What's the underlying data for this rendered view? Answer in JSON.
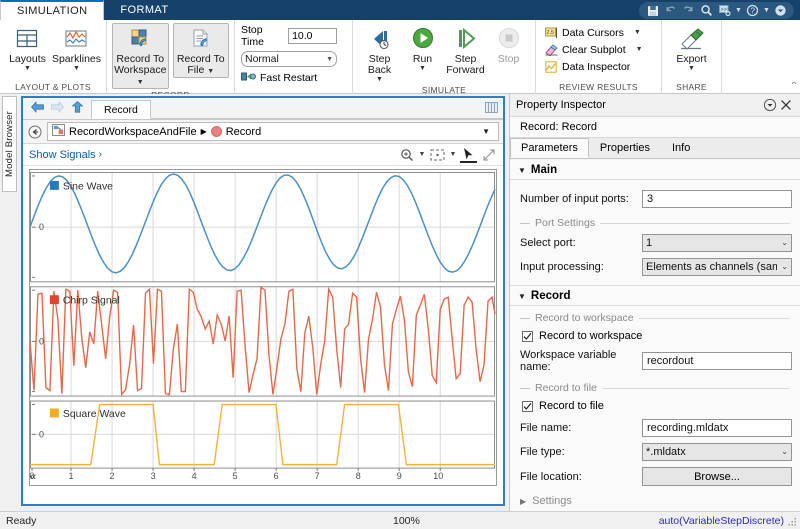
{
  "window": {
    "tabs": [
      {
        "label": "SIMULATION",
        "active": true
      },
      {
        "label": "FORMAT",
        "active": false
      }
    ],
    "quick_access": [
      "save-icon",
      "undo-icon",
      "redo-icon",
      "search-icon",
      "shortcuts-icon",
      "chevron-down-icon",
      "help-icon",
      "chevron-down-icon-2",
      "expand-icon"
    ]
  },
  "ribbon": {
    "groups": [
      {
        "title": "LAYOUT & PLOTS",
        "buttons": [
          {
            "label": "Layouts",
            "icon": "layouts-icon",
            "caret": true
          },
          {
            "label": "Sparklines",
            "icon": "sparklines-icon",
            "caret": true
          }
        ]
      },
      {
        "title": "RECORD",
        "buttons": [
          {
            "label": "Record To Workspace",
            "icon": "record-to-workspace-icon",
            "caret": true
          },
          {
            "label": "Record To File",
            "icon": "record-to-file-icon",
            "caret": true
          }
        ]
      },
      {
        "title": "",
        "stop_time_label": "Stop Time",
        "stop_time_value": "10.0",
        "sim_mode": "Normal",
        "fast_restart": "Fast Restart"
      },
      {
        "title": "SIMULATE",
        "buttons": [
          {
            "label": "Step Back",
            "icon": "step-back-icon",
            "caret": true
          },
          {
            "label": "Run",
            "icon": "run-icon",
            "caret": true
          },
          {
            "label": "Step Forward",
            "icon": "step-forward-icon",
            "caret": false
          },
          {
            "label": "Stop",
            "icon": "stop-icon",
            "caret": false,
            "disabled": true
          }
        ]
      },
      {
        "title": "REVIEW RESULTS",
        "items": [
          {
            "label": "Data Cursors",
            "icon": "data-cursors-icon",
            "caret": true
          },
          {
            "label": "Clear Subplot",
            "icon": "clear-subplot-icon",
            "caret": true
          },
          {
            "label": "Data Inspector",
            "icon": "data-inspector-icon",
            "caret": false
          }
        ]
      },
      {
        "title": "SHARE",
        "buttons": [
          {
            "label": "Export",
            "icon": "export-icon",
            "caret": true
          }
        ]
      }
    ]
  },
  "model_browser": {
    "label": "Model Browser"
  },
  "scope": {
    "tab_label": "Record",
    "breadcrumb": {
      "model": "RecordWorkspaceAndFile",
      "separator": "▶",
      "block": "Record"
    },
    "show_signals": "Show Signals",
    "show_signals_caret": "›",
    "tools": [
      "zoom-in-icon",
      "pan-fit-icon",
      "cursor-icon",
      "maximize-icon"
    ]
  },
  "chart_data": {
    "type": "line",
    "title": "",
    "xlabel": "",
    "ylabel": "",
    "xlim": [
      0,
      10
    ],
    "xticks": [
      0,
      1,
      2,
      3,
      4,
      5,
      6,
      7,
      8,
      9,
      10
    ],
    "grid": true,
    "subplots": [
      {
        "name": "Sine Wave",
        "color": "#4a90c4",
        "ylim": [
          -1.25,
          1.25
        ],
        "yticks": [
          0
        ],
        "ytick_labels": [
          "0"
        ],
        "description": "Sine wave, amplitude 1, about 3.5 cycles over 0 to 10 seconds"
      },
      {
        "name": "Chirp Signal",
        "color": "#e2694a",
        "ylim": [
          -1.25,
          1.25
        ],
        "yticks": [
          0
        ],
        "ytick_labels": [
          "0"
        ],
        "description": "Chirp signal sampled coarsely, increasing frequency, amplitude 1 over 0 to 10 seconds"
      },
      {
        "name": "Square Wave",
        "color": "#f2b33d",
        "ylim": [
          -1.25,
          1.25
        ],
        "yticks": [
          0
        ],
        "ytick_labels": [
          "0"
        ],
        "description": "Square wave alternating between -1 and 1 with period about 3 seconds"
      }
    ]
  },
  "property_inspector": {
    "title": "Property Inspector",
    "subtitle": "Record: Record",
    "tabs": [
      {
        "label": "Parameters",
        "active": true
      },
      {
        "label": "Properties",
        "active": false
      },
      {
        "label": "Info",
        "active": false
      }
    ],
    "sections": [
      {
        "title": "Main",
        "expanded": true,
        "fields": [
          {
            "type": "text",
            "label": "Number of input ports:",
            "value": "3"
          },
          {
            "type": "group",
            "label": "Port Settings"
          },
          {
            "type": "combo",
            "label": "Select port:",
            "value": "1"
          },
          {
            "type": "combo",
            "label": "Input processing:",
            "value": "Elements as channels (sample"
          }
        ]
      },
      {
        "title": "Record",
        "expanded": true,
        "fields": [
          {
            "type": "group",
            "label": "Record to workspace"
          },
          {
            "type": "check",
            "label": "Record to workspace",
            "checked": true
          },
          {
            "type": "text",
            "label": "Workspace variable name:",
            "value": "recordout"
          },
          {
            "type": "group",
            "label": "Record to file"
          },
          {
            "type": "check",
            "label": "Record to file",
            "checked": true
          },
          {
            "type": "text",
            "label": "File name:",
            "value": "recording.mldatx"
          },
          {
            "type": "combo",
            "label": "File type:",
            "value": "*.mldatx"
          },
          {
            "type": "button",
            "label": "File location:",
            "value": "Browse..."
          }
        ]
      }
    ],
    "settings_label": "Settings"
  },
  "status_bar": {
    "ready": "Ready",
    "zoom": "100%",
    "solver": "auto(VariableStepDiscrete)"
  },
  "colors": {
    "ribbon_tab_bg": "#15416b",
    "accent": "#0072bd",
    "sine": "#4a90c4",
    "chirp": "#e2694a",
    "square": "#f2b33d",
    "solver_text": "#2b2bb5",
    "link": "#0b5ea8"
  }
}
